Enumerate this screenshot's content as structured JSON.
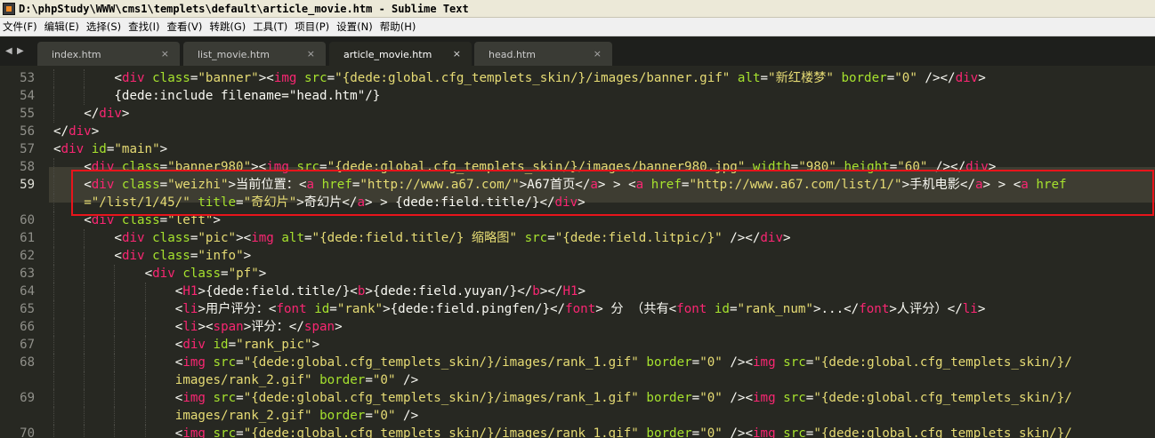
{
  "window": {
    "title": "D:\\phpStudy\\WWW\\cms1\\templets\\default\\article_movie.htm - Sublime Text"
  },
  "menu": [
    "文件(F)",
    "编辑(E)",
    "选择(S)",
    "查找(I)",
    "查看(V)",
    "转跳(G)",
    "工具(T)",
    "项目(P)",
    "设置(N)",
    "帮助(H)"
  ],
  "tabs": [
    {
      "label": "index.htm",
      "close": "×",
      "active": false
    },
    {
      "label": "list_movie.htm",
      "close": "×",
      "active": false
    },
    {
      "label": "article_movie.htm",
      "close": "×",
      "active": true
    },
    {
      "label": "head.htm",
      "close": "×",
      "active": false
    }
  ],
  "tab_nav": {
    "prev": "◀",
    "next": "▶"
  },
  "editor": {
    "current_line": 59,
    "lines": [
      {
        "n": "53",
        "indent": 8,
        "segs": [
          [
            "p",
            "<"
          ],
          [
            "t",
            "div"
          ],
          [
            "p",
            " "
          ],
          [
            "a",
            "class"
          ],
          [
            "p",
            "="
          ],
          [
            "s",
            "\"banner\""
          ],
          [
            "p",
            "><"
          ],
          [
            "t",
            "img"
          ],
          [
            "p",
            " "
          ],
          [
            "a",
            "src"
          ],
          [
            "p",
            "="
          ],
          [
            "s",
            "\"{dede:global.cfg_templets_skin/}/images/banner.gif\""
          ],
          [
            "p",
            " "
          ],
          [
            "a",
            "alt"
          ],
          [
            "p",
            "="
          ],
          [
            "s",
            "\"新红楼梦\""
          ],
          [
            "p",
            " "
          ],
          [
            "a",
            "border"
          ],
          [
            "p",
            "="
          ],
          [
            "s",
            "\"0\""
          ],
          [
            "p",
            " /></"
          ],
          [
            "t",
            "div"
          ],
          [
            "p",
            ">"
          ]
        ]
      },
      {
        "n": "54",
        "indent": 8,
        "segs": [
          [
            "p",
            "{dede:include filename=\"head.htm\"/}"
          ]
        ]
      },
      {
        "n": "55",
        "indent": 4,
        "segs": [
          [
            "p",
            "</"
          ],
          [
            "t",
            "div"
          ],
          [
            "p",
            ">"
          ]
        ]
      },
      {
        "n": "56",
        "indent": 0,
        "segs": [
          [
            "p",
            "</"
          ],
          [
            "t",
            "div"
          ],
          [
            "p",
            ">"
          ]
        ]
      },
      {
        "n": "57",
        "indent": 0,
        "segs": [
          [
            "p",
            "<"
          ],
          [
            "t",
            "div"
          ],
          [
            "p",
            " "
          ],
          [
            "a",
            "id"
          ],
          [
            "p",
            "="
          ],
          [
            "s",
            "\"main\""
          ],
          [
            "p",
            ">"
          ]
        ]
      },
      {
        "n": "58",
        "indent": 4,
        "segs": [
          [
            "p",
            "<"
          ],
          [
            "t",
            "div"
          ],
          [
            "p",
            " "
          ],
          [
            "a",
            "class"
          ],
          [
            "p",
            "="
          ],
          [
            "s",
            "\"banner980\""
          ],
          [
            "p",
            "><"
          ],
          [
            "t",
            "img"
          ],
          [
            "p",
            " "
          ],
          [
            "a",
            "src"
          ],
          [
            "p",
            "="
          ],
          [
            "s",
            "\"{dede:global.cfg_templets_skin/}/images/banner980.jpg\""
          ],
          [
            "p",
            " "
          ],
          [
            "a",
            "width"
          ],
          [
            "p",
            "="
          ],
          [
            "s",
            "\"980\""
          ],
          [
            "p",
            " "
          ],
          [
            "a",
            "height"
          ],
          [
            "p",
            "="
          ],
          [
            "s",
            "\"60\""
          ],
          [
            "p",
            " /></"
          ],
          [
            "t",
            "div"
          ],
          [
            "p",
            ">"
          ]
        ]
      },
      {
        "n": "59",
        "indent": 4,
        "segs": [
          [
            "p",
            "<"
          ],
          [
            "t",
            "div"
          ],
          [
            "p",
            " "
          ],
          [
            "a",
            "class"
          ],
          [
            "p",
            "="
          ],
          [
            "s",
            "\"weizhi\""
          ],
          [
            "p",
            ">当前位置："
          ],
          [
            "p",
            "<"
          ],
          [
            "t",
            "a"
          ],
          [
            "p",
            " "
          ],
          [
            "a",
            "href"
          ],
          [
            "p",
            "="
          ],
          [
            "s",
            "\"http://www.a67.com/\""
          ],
          [
            "p",
            ">A67首页</"
          ],
          [
            "t",
            "a"
          ],
          [
            "p",
            "> > <"
          ],
          [
            "t",
            "a"
          ],
          [
            "p",
            " "
          ],
          [
            "a",
            "href"
          ],
          [
            "p",
            "="
          ],
          [
            "s",
            "\"http://www.a67.com/list/1/\""
          ],
          [
            "p",
            ">手机电影</"
          ],
          [
            "t",
            "a"
          ],
          [
            "p",
            "> > <"
          ],
          [
            "t",
            "a"
          ],
          [
            "p",
            " "
          ],
          [
            "a",
            "href"
          ]
        ]
      },
      {
        "n": "",
        "indent": 4,
        "segs": [
          [
            "s",
            "=\"/list/1/45/\""
          ],
          [
            "p",
            " "
          ],
          [
            "a",
            "title"
          ],
          [
            "p",
            "="
          ],
          [
            "s",
            "\"奇幻片\""
          ],
          [
            "p",
            ">奇幻片</"
          ],
          [
            "t",
            "a"
          ],
          [
            "p",
            "> > {dede:field.title/}</"
          ],
          [
            "t",
            "div"
          ],
          [
            "p",
            ">"
          ]
        ]
      },
      {
        "n": "60",
        "indent": 4,
        "segs": [
          [
            "p",
            "<"
          ],
          [
            "t",
            "div"
          ],
          [
            "p",
            " "
          ],
          [
            "a",
            "class"
          ],
          [
            "p",
            "="
          ],
          [
            "s",
            "\"left\""
          ],
          [
            "p",
            ">"
          ]
        ]
      },
      {
        "n": "61",
        "indent": 8,
        "segs": [
          [
            "p",
            "<"
          ],
          [
            "t",
            "div"
          ],
          [
            "p",
            " "
          ],
          [
            "a",
            "class"
          ],
          [
            "p",
            "="
          ],
          [
            "s",
            "\"pic\""
          ],
          [
            "p",
            "><"
          ],
          [
            "t",
            "img"
          ],
          [
            "p",
            " "
          ],
          [
            "a",
            "alt"
          ],
          [
            "p",
            "="
          ],
          [
            "s",
            "\"{dede:field.title/} 缩略图\""
          ],
          [
            "p",
            " "
          ],
          [
            "a",
            "src"
          ],
          [
            "p",
            "="
          ],
          [
            "s",
            "\"{dede:field.litpic/}\""
          ],
          [
            "p",
            " /></"
          ],
          [
            "t",
            "div"
          ],
          [
            "p",
            ">"
          ]
        ]
      },
      {
        "n": "62",
        "indent": 8,
        "segs": [
          [
            "p",
            "<"
          ],
          [
            "t",
            "div"
          ],
          [
            "p",
            " "
          ],
          [
            "a",
            "class"
          ],
          [
            "p",
            "="
          ],
          [
            "s",
            "\"info\""
          ],
          [
            "p",
            ">"
          ]
        ]
      },
      {
        "n": "63",
        "indent": 12,
        "segs": [
          [
            "p",
            "<"
          ],
          [
            "t",
            "div"
          ],
          [
            "p",
            " "
          ],
          [
            "a",
            "class"
          ],
          [
            "p",
            "="
          ],
          [
            "s",
            "\"pf\""
          ],
          [
            "p",
            ">"
          ]
        ]
      },
      {
        "n": "64",
        "indent": 16,
        "segs": [
          [
            "p",
            "<"
          ],
          [
            "t",
            "H1"
          ],
          [
            "p",
            ">{dede:field.title/}<"
          ],
          [
            "t",
            "b"
          ],
          [
            "p",
            ">{dede:field.yuyan/}</"
          ],
          [
            "t",
            "b"
          ],
          [
            "p",
            "></"
          ],
          [
            "t",
            "H1"
          ],
          [
            "p",
            ">"
          ]
        ]
      },
      {
        "n": "65",
        "indent": 16,
        "segs": [
          [
            "p",
            "<"
          ],
          [
            "t",
            "li"
          ],
          [
            "p",
            ">用户评分："
          ],
          [
            "p",
            "<"
          ],
          [
            "t",
            "font"
          ],
          [
            "p",
            " "
          ],
          [
            "a",
            "id"
          ],
          [
            "p",
            "="
          ],
          [
            "s",
            "\"rank\""
          ],
          [
            "p",
            ">{dede:field.pingfen/}</"
          ],
          [
            "t",
            "font"
          ],
          [
            "p",
            "> 分 （共有<"
          ],
          [
            "t",
            "font"
          ],
          [
            "p",
            " "
          ],
          [
            "a",
            "id"
          ],
          [
            "p",
            "="
          ],
          [
            "s",
            "\"rank_num\""
          ],
          [
            "p",
            ">...</"
          ],
          [
            "t",
            "font"
          ],
          [
            "p",
            ">人评分）</"
          ],
          [
            "t",
            "li"
          ],
          [
            "p",
            ">"
          ]
        ]
      },
      {
        "n": "66",
        "indent": 16,
        "segs": [
          [
            "p",
            "<"
          ],
          [
            "t",
            "li"
          ],
          [
            "p",
            "><"
          ],
          [
            "t",
            "span"
          ],
          [
            "p",
            ">评分：</"
          ],
          [
            "t",
            "span"
          ],
          [
            "p",
            ">"
          ]
        ]
      },
      {
        "n": "67",
        "indent": 16,
        "segs": [
          [
            "p",
            "<"
          ],
          [
            "t",
            "div"
          ],
          [
            "p",
            " "
          ],
          [
            "a",
            "id"
          ],
          [
            "p",
            "="
          ],
          [
            "s",
            "\"rank_pic\""
          ],
          [
            "p",
            ">"
          ]
        ]
      },
      {
        "n": "68",
        "indent": 16,
        "segs": [
          [
            "p",
            "<"
          ],
          [
            "t",
            "img"
          ],
          [
            "p",
            " "
          ],
          [
            "a",
            "src"
          ],
          [
            "p",
            "="
          ],
          [
            "s",
            "\"{dede:global.cfg_templets_skin/}/images/rank_1.gif\""
          ],
          [
            "p",
            " "
          ],
          [
            "a",
            "border"
          ],
          [
            "p",
            "="
          ],
          [
            "s",
            "\"0\""
          ],
          [
            "p",
            " /><"
          ],
          [
            "t",
            "img"
          ],
          [
            "p",
            " "
          ],
          [
            "a",
            "src"
          ],
          [
            "p",
            "="
          ],
          [
            "s",
            "\"{dede:global.cfg_templets_skin/}/"
          ]
        ]
      },
      {
        "n": "",
        "indent": 16,
        "segs": [
          [
            "s",
            "images/rank_2.gif\""
          ],
          [
            "p",
            " "
          ],
          [
            "a",
            "border"
          ],
          [
            "p",
            "="
          ],
          [
            "s",
            "\"0\""
          ],
          [
            "p",
            " />"
          ]
        ]
      },
      {
        "n": "69",
        "indent": 16,
        "segs": [
          [
            "p",
            "<"
          ],
          [
            "t",
            "img"
          ],
          [
            "p",
            " "
          ],
          [
            "a",
            "src"
          ],
          [
            "p",
            "="
          ],
          [
            "s",
            "\"{dede:global.cfg_templets_skin/}/images/rank_1.gif\""
          ],
          [
            "p",
            " "
          ],
          [
            "a",
            "border"
          ],
          [
            "p",
            "="
          ],
          [
            "s",
            "\"0\""
          ],
          [
            "p",
            " /><"
          ],
          [
            "t",
            "img"
          ],
          [
            "p",
            " "
          ],
          [
            "a",
            "src"
          ],
          [
            "p",
            "="
          ],
          [
            "s",
            "\"{dede:global.cfg_templets_skin/}/"
          ]
        ]
      },
      {
        "n": "",
        "indent": 16,
        "segs": [
          [
            "s",
            "images/rank_2.gif\""
          ],
          [
            "p",
            " "
          ],
          [
            "a",
            "border"
          ],
          [
            "p",
            "="
          ],
          [
            "s",
            "\"0\""
          ],
          [
            "p",
            " />"
          ]
        ]
      },
      {
        "n": "70",
        "indent": 16,
        "segs": [
          [
            "p",
            "<"
          ],
          [
            "t",
            "img"
          ],
          [
            "p",
            " "
          ],
          [
            "a",
            "src"
          ],
          [
            "p",
            "="
          ],
          [
            "s",
            "\"{dede:global.cfg_templets_skin/}/images/rank_1.gif\""
          ],
          [
            "p",
            " "
          ],
          [
            "a",
            "border"
          ],
          [
            "p",
            "="
          ],
          [
            "s",
            "\"0\""
          ],
          [
            "p",
            " /><"
          ],
          [
            "t",
            "img"
          ],
          [
            "p",
            " "
          ],
          [
            "a",
            "src"
          ],
          [
            "p",
            "="
          ],
          [
            "s",
            "\"{dede:global.cfg_templets_skin/}/"
          ]
        ]
      }
    ]
  },
  "colors": {
    "background": "#272822",
    "tag": "#f92672",
    "attribute": "#a6e22e",
    "string": "#e6db74",
    "plain": "#f8f8f2",
    "line_number": "#90908a",
    "highlight_box": "#e8141b"
  }
}
